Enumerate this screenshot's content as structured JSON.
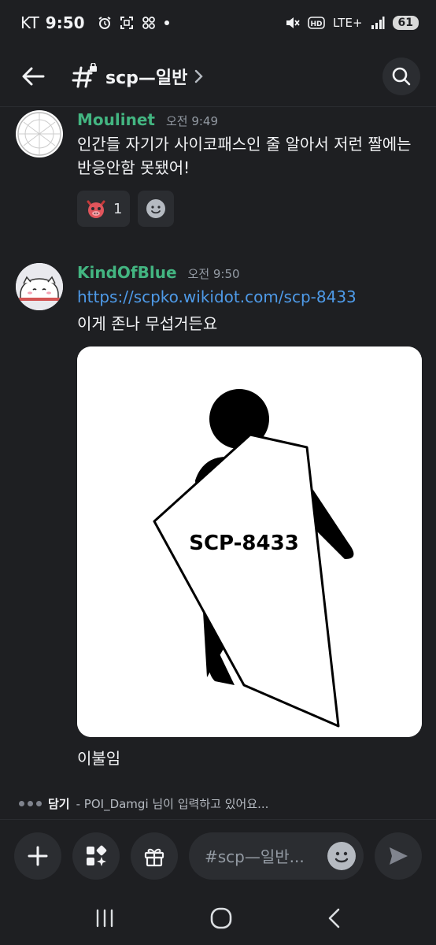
{
  "status_bar": {
    "carrier": "KT",
    "time": "9:50",
    "network": "LTE+",
    "battery": "61"
  },
  "header": {
    "channel_name": "scp—일반"
  },
  "messages": [
    {
      "username": "Moulinet",
      "timestamp": "오전 9:49",
      "text": "인간들 자기가 사이코패스인 줄 알아서 저런 짤에는 반응안함 못됐어!",
      "reactions": [
        {
          "emoji": "devil-emoji",
          "count": "1"
        }
      ],
      "name_color": "#43b581"
    },
    {
      "username": "KindOfBlue",
      "timestamp": "오전 9:50",
      "link": "https://scpko.wikidot.com/scp-8433",
      "text": "이게 존나 무섭거든요",
      "image_caption": "SCP-8433",
      "after_text": "이불임",
      "name_color": "#43b581"
    }
  ],
  "typing": {
    "user": "담기",
    "text": "- POI_Damgi 님이 입력하고 있어요..."
  },
  "composer": {
    "placeholder": "#scp—일반..."
  },
  "colors": {
    "background": "#1e1f22",
    "surface": "#2b2d31",
    "link": "#4e9ae8",
    "username": "#43b581"
  }
}
